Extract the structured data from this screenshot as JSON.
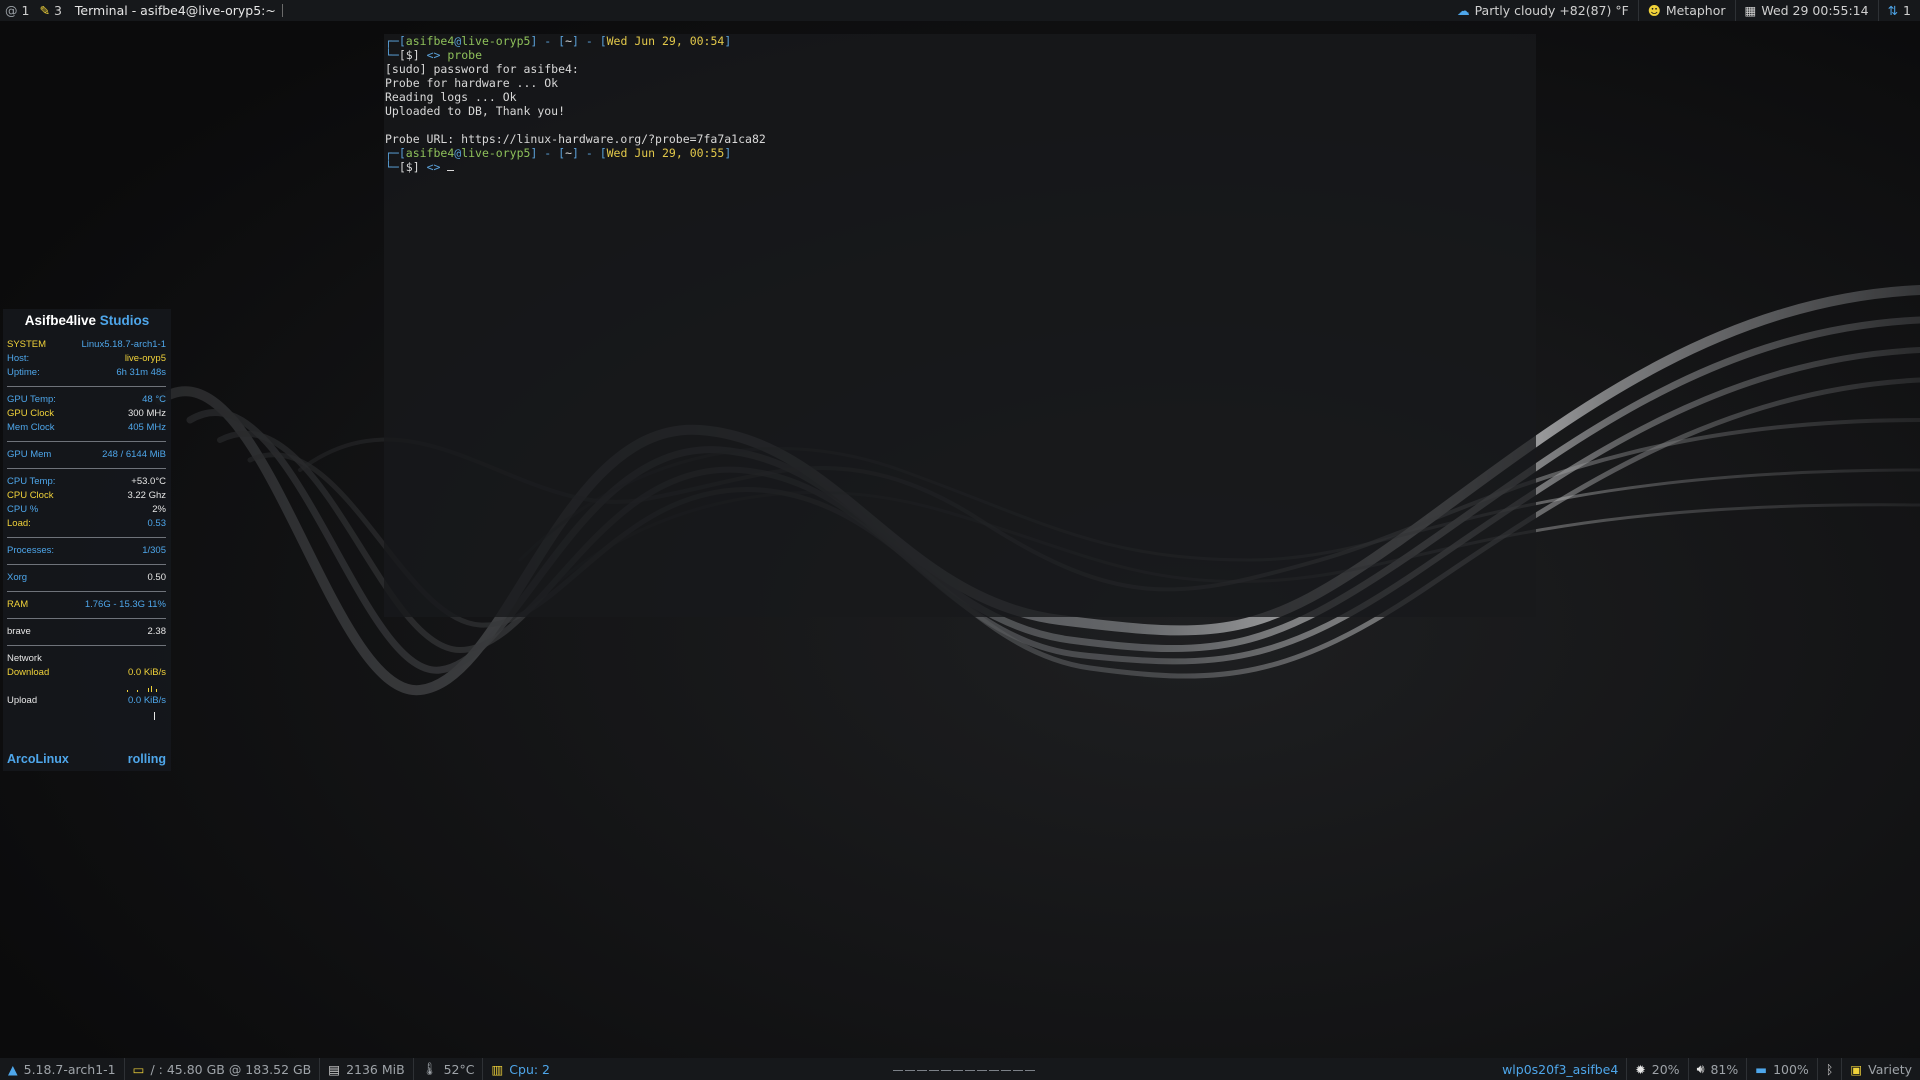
{
  "topbar": {
    "workspaces": [
      {
        "number": "1",
        "icon": "at-icon"
      },
      {
        "number": "3",
        "icon": "pencil-icon"
      }
    ],
    "window_title": "Terminal - asifbe4@live-oryp5:~",
    "weather": "Partly cloudy +82(87) °F",
    "user": "Metaphor",
    "datetime": "Wed 29 00:55:14",
    "updates": "1"
  },
  "terminal": {
    "lines": [
      {
        "user": "asifbe4",
        "host": "live-oryp5",
        "dir": "~",
        "date": "Wed Jun 29, 00:54",
        "cmd": "probe"
      },
      {
        "text": "[sudo] password for asifbe4:"
      },
      {
        "text": "Probe for hardware ... Ok"
      },
      {
        "text": "Reading logs ... Ok"
      },
      {
        "text": "Uploaded to DB, Thank you!"
      },
      {
        "text": ""
      },
      {
        "text": "Probe URL: https://linux-hardware.org/?probe=7fa7a1ca82"
      },
      {
        "user": "asifbe4",
        "host": "live-oryp5",
        "dir": "~",
        "date": "Wed Jun 29, 00:55",
        "cmd": ""
      }
    ],
    "prompt_symbol": "[$]",
    "arrow": "<>"
  },
  "conky": {
    "title_white": "Asifbe4live",
    "title_blue": "Studios",
    "system_label": "SYSTEM",
    "kernel": "Linux5.18.7-arch1-1",
    "host_label": "Host:",
    "host": "live-oryp5",
    "uptime_label": "Uptime:",
    "uptime": "6h 31m 48s",
    "gpu_temp_label": "GPU Temp:",
    "gpu_temp": "48 °C",
    "gpu_clock_label": "GPU Clock",
    "gpu_clock": "300 MHz",
    "mem_clock_label": "Mem Clock",
    "mem_clock": "405 MHz",
    "gpu_mem_label": "GPU Mem",
    "gpu_mem": "248 / 6144 MiB",
    "cpu_temp_label": "CPU Temp:",
    "cpu_temp": "+53.0°C",
    "cpu_clock_label": "CPU Clock",
    "cpu_clock": "3.22 Ghz",
    "cpu_pct_label": "CPU %",
    "cpu_pct": "2%",
    "load_label": "Load:",
    "load": "0.53",
    "processes_label": "Processes:",
    "processes": "1/305",
    "xorg_label": "Xorg",
    "xorg": "0.50",
    "ram_label": "RAM",
    "ram": "1.76G - 15.3G 11%",
    "brave_label": "brave",
    "brave": "2.38",
    "network_label": "Network",
    "download_label": "Download",
    "download": "0.0 KiB/s",
    "upload_label": "Upload",
    "upload": "0.0 KiB/s",
    "footer_left": "ArcoLinux",
    "footer_right": "rolling"
  },
  "bottombar": {
    "kernel": "5.18.7-arch1-1",
    "disk": "/ : 45.80 GB @ 183.52 GB",
    "memory": "2136 MiB",
    "temp": "52°C",
    "cpu": "Cpu: 2",
    "network": "wlp0s20f3_asifbe4",
    "brightness": "20%",
    "volume": "81%",
    "battery": "100%",
    "wallpaper_app": "Variety"
  },
  "colors": {
    "accent_blue": "#4ea6ea",
    "accent_yellow": "#f0d23a",
    "prompt_green": "#8ec05a"
  }
}
